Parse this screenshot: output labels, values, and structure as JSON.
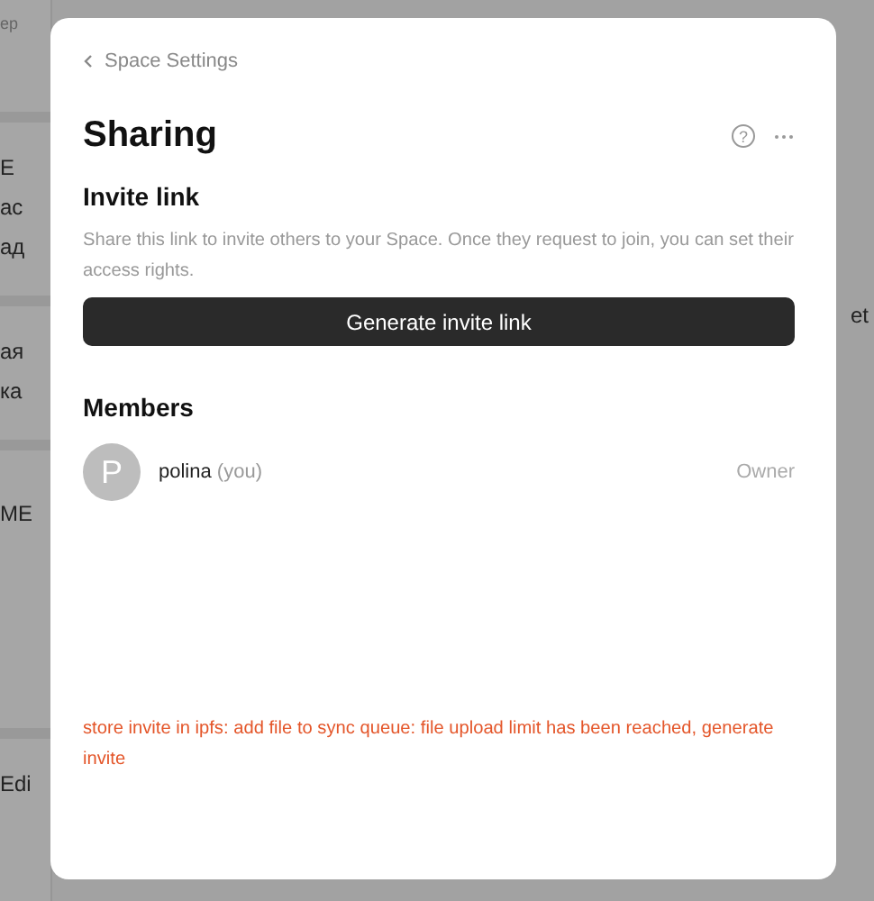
{
  "background": {
    "sidebar_groups": [
      [
        "ер"
      ],
      [
        "E",
        "ас",
        "ад"
      ],
      [
        "ая",
        "ка"
      ],
      [
        "МЕ"
      ],
      [
        "Edi"
      ]
    ],
    "right_text": "et"
  },
  "dialog": {
    "back_link": "Space Settings",
    "title": "Sharing",
    "help_icon": "?",
    "invite": {
      "heading": "Invite link",
      "description": "Share this link to invite others to your Space. Once they request to join, you can set their access rights.",
      "button": "Generate invite link"
    },
    "members": {
      "heading": "Members",
      "list": [
        {
          "initial": "P",
          "name": "polina",
          "suffix": "(you)",
          "role": "Owner"
        }
      ]
    },
    "error": "store invite in ipfs: add file to sync queue: file upload limit has been reached, generate invite"
  }
}
